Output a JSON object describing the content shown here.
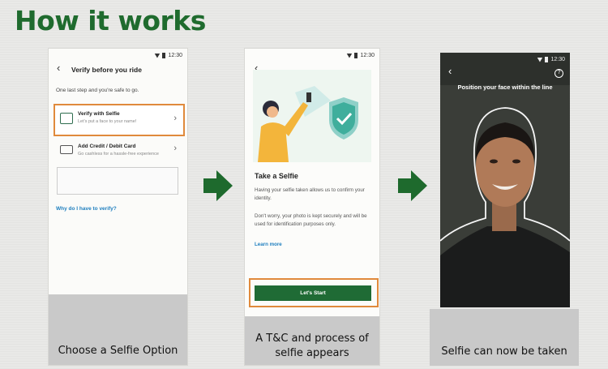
{
  "title": "How it works",
  "panel1": {
    "time": "12:30",
    "header": "Verify before you ride",
    "intro": "One last step and you're safe to go.",
    "option1_title": "Verify with Selfie",
    "option1_sub": "Let's put a face to your name!",
    "option2_title": "Add Credit / Debit Card",
    "option2_sub": "Go cashless for a hassle-free experience",
    "link": "Why do I have to verify?",
    "caption": "Choose a Selfie Option"
  },
  "panel2": {
    "time": "12:30",
    "heading": "Take a Selfie",
    "para1": "Having your selfie taken allows us to confirm your identity.",
    "para2": "Don't worry, your photo is kept securely and will be used for identification purposes only.",
    "link": "Learn more",
    "button": "Let's Start",
    "caption_line1": "A T&C and process of",
    "caption_line2": "selfie appears"
  },
  "panel3": {
    "time": "12:30",
    "instruction": "Position your face within the line",
    "caption": "Selfie can now be taken"
  },
  "colors": {
    "title_green": "#1f6b2e",
    "arrow_green": "#1e6a2d",
    "highlight_orange": "#e08a3c",
    "button_green": "#1f6b35"
  }
}
